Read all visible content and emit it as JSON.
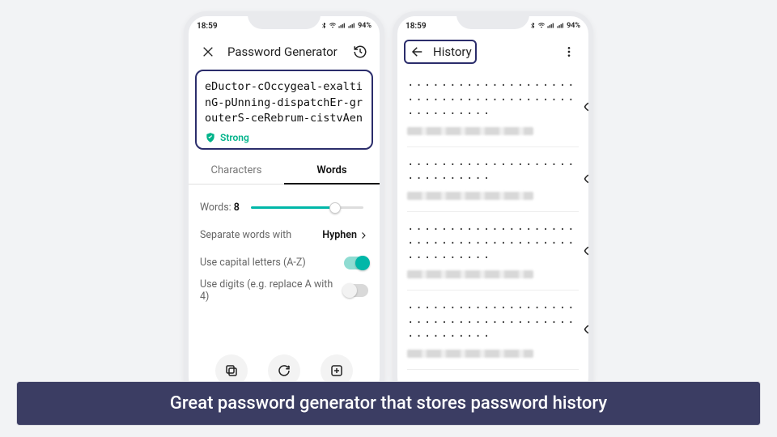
{
  "status": {
    "time": "18:59",
    "battery": "94%"
  },
  "phone_generator": {
    "title": "Password Generator",
    "password": "eDuctor-cOccygeal-exaltinG-pUnning-dispatchEr-grouterS-ceRebrum-cistvAen",
    "strength_label": "Strong",
    "tabs": {
      "characters": "Characters",
      "words": "Words"
    },
    "settings": {
      "words_label": "Words:",
      "words_value": "8",
      "separator_label": "Separate words with",
      "separator_value": "Hyphen",
      "capitals_label": "Use capital letters (A-Z)",
      "capitals_on": true,
      "digits_label": "Use digits (e.g. replace A with 4)",
      "digits_on": false
    }
  },
  "phone_history": {
    "title": "History",
    "items": [
      {
        "lines": 3
      },
      {
        "lines": 2
      },
      {
        "lines": 3
      },
      {
        "lines": 3
      }
    ]
  },
  "caption": "Great password generator that stores password history"
}
